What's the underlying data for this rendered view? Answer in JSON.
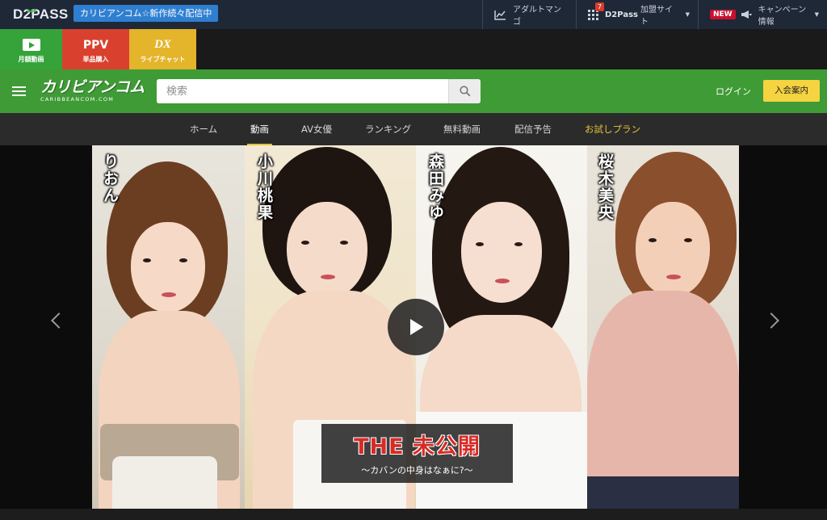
{
  "topbar": {
    "logo": "D2PASS",
    "news_badge": "カリビアンコム☆新作続々配信中",
    "adult_manga": "アダルトマンゴ",
    "d2pass_count": "7",
    "d2pass_sites_brand": "D2Pass",
    "d2pass_sites_suffix": "加盟サイト",
    "new_badge": "NEW",
    "campaign": "キャンペーン情報"
  },
  "services": {
    "monthly_label": "月額動画",
    "ppv_top": "PPV",
    "ppv_label": "単品購入",
    "live_top": "DX",
    "live_label": "ライブチャット"
  },
  "header": {
    "logo_main": "カリビアンコム",
    "logo_sub": "CARIBBEANCOM.COM",
    "search_placeholder": "検索",
    "login": "ログイン",
    "join": "入会案内"
  },
  "nav": {
    "items": [
      "ホーム",
      "動画",
      "AV女優",
      "ランキング",
      "無料動画",
      "配信予告",
      "お試しプラン"
    ],
    "active_index": 1
  },
  "hero": {
    "performers": [
      "りおん",
      "小川桃果",
      "森田みゆ",
      "桜木美央"
    ],
    "title_main": "THE 未公開",
    "title_sub": "〜カバンの中身はなぁに?〜"
  },
  "colors": {
    "topbar_bg": "#1f2837",
    "green_header": "#3f9b35",
    "ppv_red": "#d9412e",
    "live_yellow": "#e4b42a",
    "accent_gold": "#e6c23a",
    "title_red": "#d92b25"
  },
  "icons": {
    "adult_manga": "trend-chart-icon",
    "d2pass_sites": "grid-icon",
    "campaign": "megaphone-icon",
    "search": "search-icon",
    "menu": "hamburger-icon"
  }
}
